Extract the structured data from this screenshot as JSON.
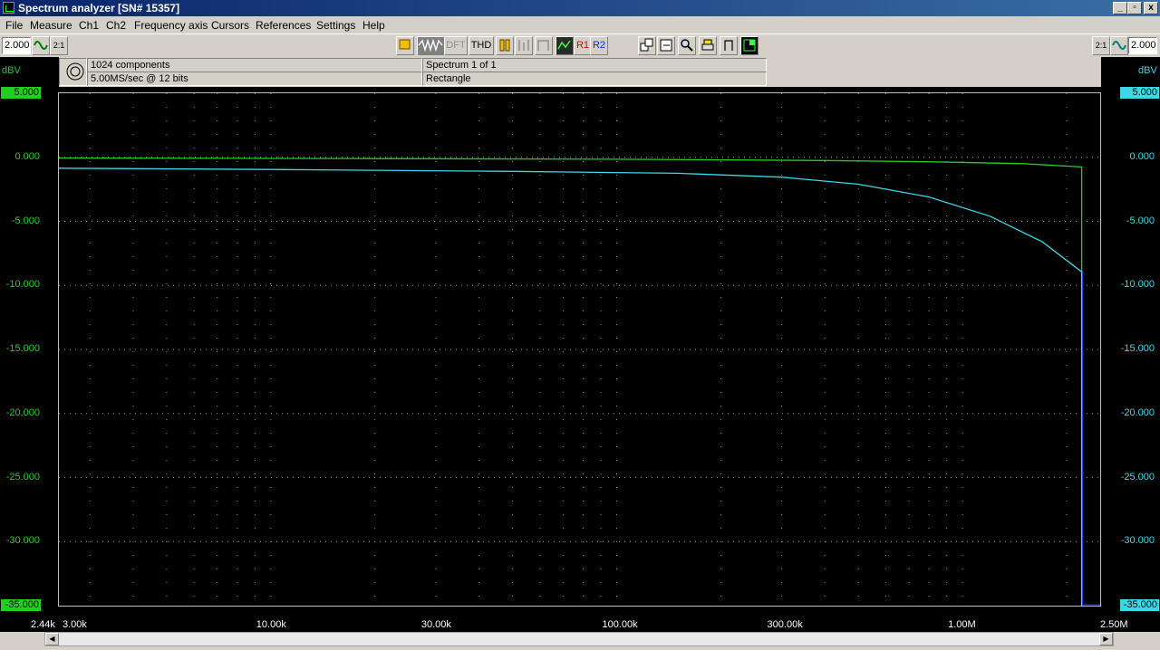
{
  "window": {
    "title": "Spectrum analyzer  [SN# 15357]",
    "buttons": [
      "_",
      "▫",
      "x"
    ]
  },
  "menu": [
    "File",
    "Measure",
    "Ch1",
    "Ch2",
    "Frequency axis",
    "Cursors",
    "References",
    "Settings",
    "Help"
  ],
  "toolbar": {
    "left_value": "2.000",
    "left_ratio": "2:1",
    "right_ratio": "2:1",
    "right_value": "2.000",
    "dft_label": "DFT",
    "thd_label": "THD",
    "r1_label": "R1",
    "r2_label": "R2"
  },
  "info": {
    "components": "1024 components",
    "sample_rate": "5.00MS/sec @ 12 bits",
    "spectrum": "Spectrum 1 of 1",
    "window": "Rectangle"
  },
  "axes": {
    "left_unit": "dBV",
    "right_unit": "dBV",
    "left_colors": {
      "ch1": "#20d020",
      "ch2": "#3ad8e8"
    },
    "y_ticks": [
      "5.000",
      "0.000",
      "-5.000",
      "-10.000",
      "-15.000",
      "-20.000",
      "-25.000",
      "-30.000",
      "-35.000"
    ],
    "x_ticks": [
      "2.44k",
      "3.00k",
      "10.00k",
      "30.00k",
      "100.00k",
      "300.00k",
      "1.00M",
      "2.50M"
    ]
  },
  "chart_data": {
    "type": "line",
    "xscale": "log",
    "xlim": [
      2440,
      2500000
    ],
    "ylim": [
      -35,
      5
    ],
    "ylabel": "dBV",
    "series": [
      {
        "color": "#20d020",
        "x": [
          2440,
          20000,
          100000,
          400000,
          800000,
          1500000,
          2200000,
          2210000,
          2211000
        ],
        "y": [
          -0.05,
          -0.1,
          -0.15,
          -0.25,
          -0.35,
          -0.5,
          -0.75,
          -0.75,
          -35
        ]
      },
      {
        "color": "#3ad8e8",
        "x": [
          2440,
          10000,
          50000,
          150000,
          300000,
          500000,
          800000,
          1200000,
          1700000,
          2200000,
          2210000,
          2211000
        ],
        "y": [
          -0.85,
          -0.95,
          -1.1,
          -1.25,
          -1.55,
          -2.1,
          -3.1,
          -4.6,
          -6.6,
          -8.9,
          -8.9,
          -35
        ]
      }
    ]
  }
}
